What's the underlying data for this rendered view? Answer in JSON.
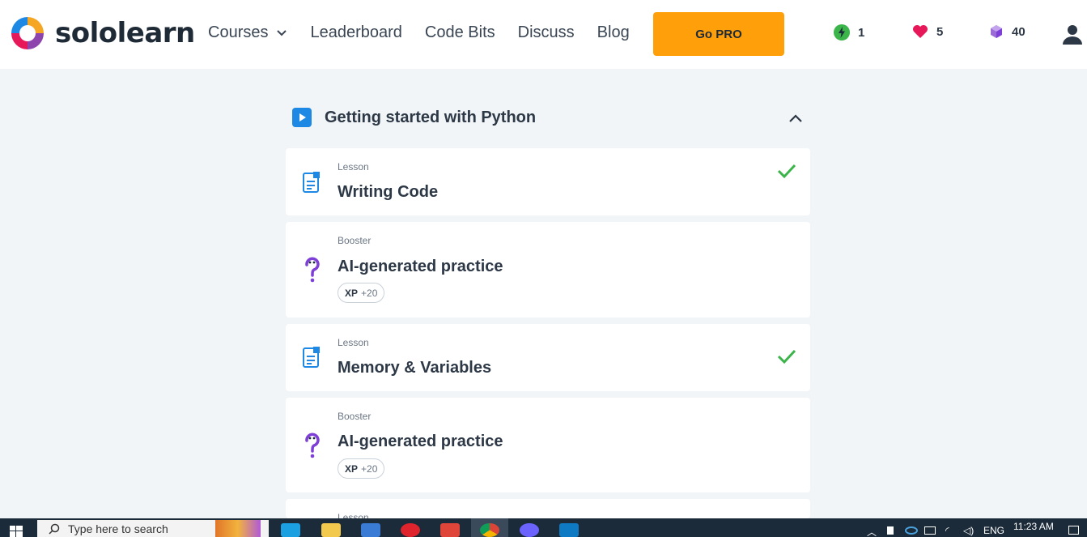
{
  "brand": {
    "name": "sololearn"
  },
  "nav": {
    "items": [
      {
        "label": "Courses",
        "has_dropdown": true
      },
      {
        "label": "Leaderboard"
      },
      {
        "label": "Code Bits"
      },
      {
        "label": "Discuss"
      },
      {
        "label": "Blog"
      }
    ]
  },
  "header": {
    "go_pro_label": "Go PRO",
    "streak_count": "1",
    "hearts_count": "5",
    "gems_count": "40"
  },
  "module": {
    "title": "Getting started with Python",
    "expanded": true
  },
  "cards": [
    {
      "kind": "Lesson",
      "title": "Writing Code",
      "completed": true,
      "icon": "document-icon"
    },
    {
      "kind": "Booster",
      "title": "AI-generated practice",
      "xp_label": "XP",
      "xp_value": "+20",
      "icon": "question-icon"
    },
    {
      "kind": "Lesson",
      "title": "Memory & Variables",
      "completed": true,
      "icon": "document-icon"
    },
    {
      "kind": "Booster",
      "title": "AI-generated practice",
      "xp_label": "XP",
      "xp_value": "+20",
      "icon": "question-icon"
    },
    {
      "kind": "Lesson"
    }
  ],
  "taskbar": {
    "search_placeholder": "Type here to search",
    "language": "ENG",
    "time": "11:23 AM"
  },
  "colors": {
    "accent_orange": "#ff9f0a",
    "check_green": "#3bb54a",
    "lesson_blue": "#1e88e5",
    "booster_purple": "#7e3fd6"
  }
}
